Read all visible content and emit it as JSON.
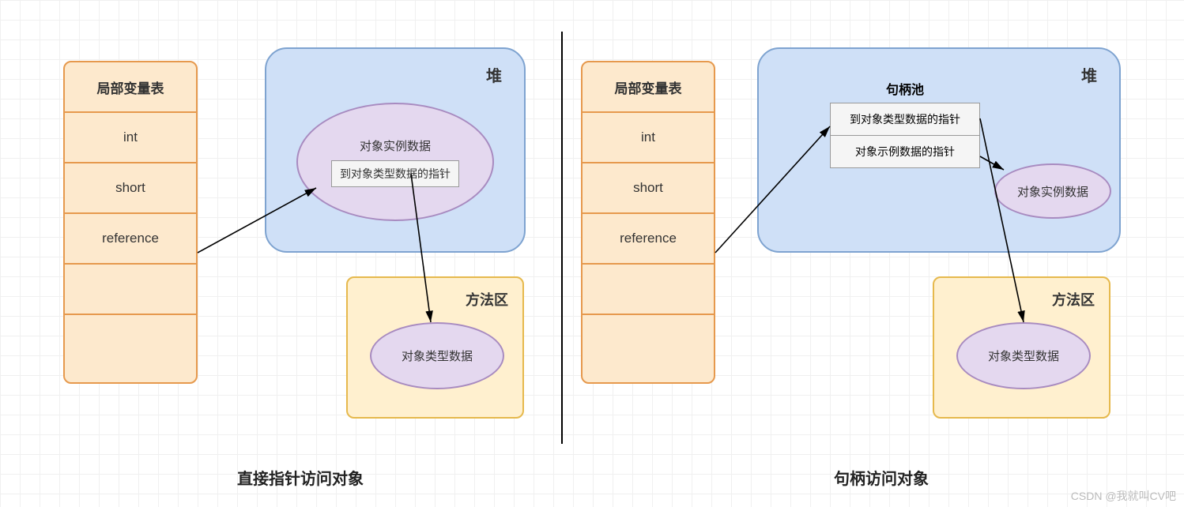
{
  "left": {
    "lvt_title": "局部变量表",
    "rows": [
      "int",
      "short",
      "reference"
    ],
    "heap_title": "堆",
    "ellipse_title": "对象实例数据",
    "inner_pointer": "到对象类型数据的指针",
    "method_title": "方法区",
    "type_data": "对象类型数据",
    "caption": "直接指针访问对象"
  },
  "right": {
    "lvt_title": "局部变量表",
    "rows": [
      "int",
      "short",
      "reference"
    ],
    "heap_title": "堆",
    "handle_pool_title": "句柄池",
    "hp_rows": [
      "到对象类型数据的指针",
      "对象示例数据的指针"
    ],
    "instance_data": "对象实例数据",
    "method_title": "方法区",
    "type_data": "对象类型数据",
    "caption": "句柄访问对象"
  },
  "watermark": "CSDN @我就叫CV吧"
}
